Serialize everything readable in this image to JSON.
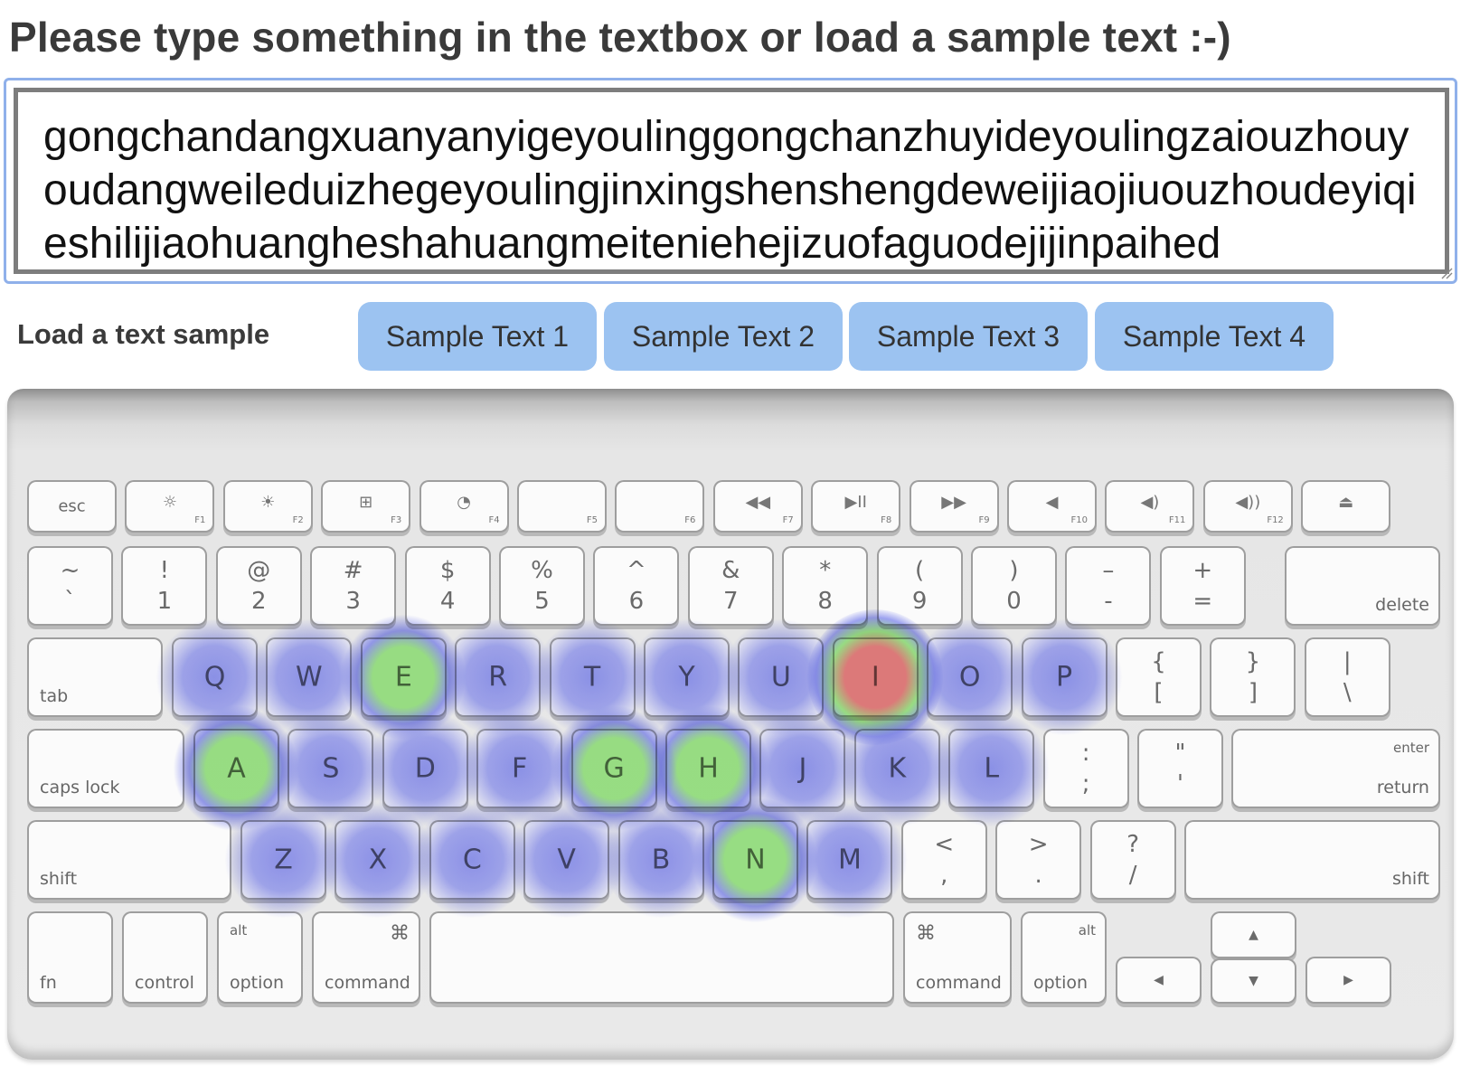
{
  "header": {
    "title": "Please type something in the textbox or load a sample text :-)"
  },
  "textbox": {
    "value": "gongchandangxuanyanyigeyoulinggongchanzhuyideyoulingzaiouzhouyoudangweileduizhegeyoulingjinxingshenshengdeweijiaojiuouzhoudeyiqieshilijiaohuangheshahuangmeiteniehejizuofaguodejijinpaihed"
  },
  "samples": {
    "label": "Load a text sample",
    "buttons": [
      "Sample Text 1",
      "Sample Text 2",
      "Sample Text 3",
      "Sample Text 4"
    ]
  },
  "keyboard": {
    "fn_row": [
      {
        "main": "esc"
      },
      {
        "icon": "☼",
        "fn": "F1"
      },
      {
        "icon": "☀",
        "fn": "F2"
      },
      {
        "icon": "⊞",
        "fn": "F3"
      },
      {
        "icon": "◔",
        "fn": "F4"
      },
      {
        "icon": "",
        "fn": "F5"
      },
      {
        "icon": "",
        "fn": "F6"
      },
      {
        "icon": "◀◀",
        "fn": "F7"
      },
      {
        "icon": "▶II",
        "fn": "F8"
      },
      {
        "icon": "▶▶",
        "fn": "F9"
      },
      {
        "icon": "◀",
        "fn": "F10"
      },
      {
        "icon": "◀)",
        "fn": "F11"
      },
      {
        "icon": "◀))",
        "fn": "F12"
      },
      {
        "icon": "⏏"
      }
    ],
    "number_row": [
      [
        "~",
        "`"
      ],
      [
        "!",
        "1"
      ],
      [
        "@",
        "2"
      ],
      [
        "#",
        "3"
      ],
      [
        "$",
        "4"
      ],
      [
        "%",
        "5"
      ],
      [
        "^",
        "6"
      ],
      [
        "&",
        "7"
      ],
      [
        "*",
        "8"
      ],
      [
        "(",
        "9"
      ],
      [
        ")",
        "0"
      ],
      [
        "–",
        "-"
      ],
      [
        "+",
        "="
      ]
    ],
    "delete_label": "delete",
    "tab_label": "tab",
    "top_letters": [
      "Q",
      "W",
      "E",
      "R",
      "T",
      "Y",
      "U",
      "I",
      "O",
      "P"
    ],
    "top_symbols": [
      [
        "{",
        "["
      ],
      [
        "}",
        "]"
      ],
      [
        "|",
        "\\"
      ]
    ],
    "caps_label": "caps lock",
    "home_letters": [
      "A",
      "S",
      "D",
      "F",
      "G",
      "H",
      "J",
      "K",
      "L"
    ],
    "home_symbols": [
      [
        ":",
        ";"
      ],
      [
        "\"",
        "'"
      ]
    ],
    "enter_top": "enter",
    "enter_bottom": "return",
    "shift_label": "shift",
    "bottom_letters": [
      "Z",
      "X",
      "C",
      "V",
      "B",
      "N",
      "M"
    ],
    "bottom_symbols": [
      [
        "<",
        ","
      ],
      [
        ">",
        "."
      ],
      [
        "?",
        "/"
      ]
    ],
    "fn_label": "fn",
    "control_label": "control",
    "alt_label": "alt",
    "option_label": "option",
    "cmd_symbol": "⌘",
    "command_label": "command",
    "arrows": {
      "up": "▲",
      "down": "▼",
      "left": "◀",
      "right": "▶"
    }
  },
  "heatmap": {
    "colors": {
      "hot": "#e8807f",
      "warm": "#9fe889",
      "cool": "#7f86f0"
    },
    "levels": {
      "I": "hot",
      "E": "warm",
      "A": "warm",
      "H": "warm",
      "N": "warm",
      "G": "warm",
      "O": "cool",
      "U": "cool",
      "Y": "cool",
      "Q": "cool",
      "W": "cool",
      "S": "cool",
      "D": "cool",
      "Z": "cool",
      "X": "cool",
      "C": "cool",
      "J": "cool",
      "L": "cool",
      "K": "cool",
      "T": "cool",
      "R": "cool",
      "F": "cool",
      "M": "cool",
      "B": "cool",
      "V": "cool",
      "P": "cool"
    }
  }
}
